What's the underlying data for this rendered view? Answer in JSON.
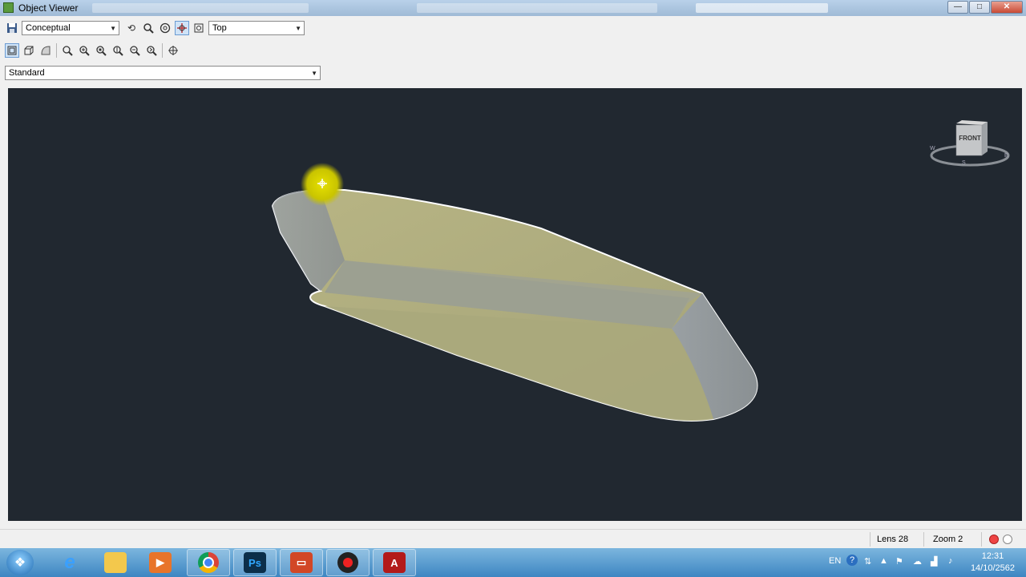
{
  "window": {
    "title": "Object Viewer",
    "controls": {
      "minimize": "—",
      "maximize": "□",
      "close": "✕"
    }
  },
  "toolbar": {
    "visual_style": "Conceptual",
    "view": "Top",
    "named_view": "Standard",
    "row1_icons": [
      "save-icon",
      "orbit-icon",
      "zoom-icon",
      "steering-wheel-icon",
      "pan-icon",
      "view-options-icon"
    ],
    "row2_icons": [
      "wireframe-icon",
      "box-icon",
      "shade-icon",
      "zoom-window-icon",
      "zoom-in-icon",
      "zoom-extents-icon",
      "zoom-realtime-icon",
      "zoom-out-icon",
      "zoom-previous-icon",
      "target-icon"
    ]
  },
  "viewcube": {
    "face_label": "FRONT",
    "compass": [
      "W",
      "S",
      "E"
    ]
  },
  "status": {
    "lens": "Lens 28",
    "zoom": "Zoom 2"
  },
  "taskbar": {
    "apps": [
      "internet-explorer",
      "file-explorer",
      "media-player",
      "chrome",
      "photoshop",
      "presentation",
      "recorder",
      "autocad"
    ],
    "language": "EN",
    "time": "12:31",
    "date": "14/10/2562"
  },
  "colors": {
    "viewport_bg": "#212830",
    "model_top": "#aba97a",
    "model_side": "#8d9396",
    "highlight": "#d9d400"
  }
}
